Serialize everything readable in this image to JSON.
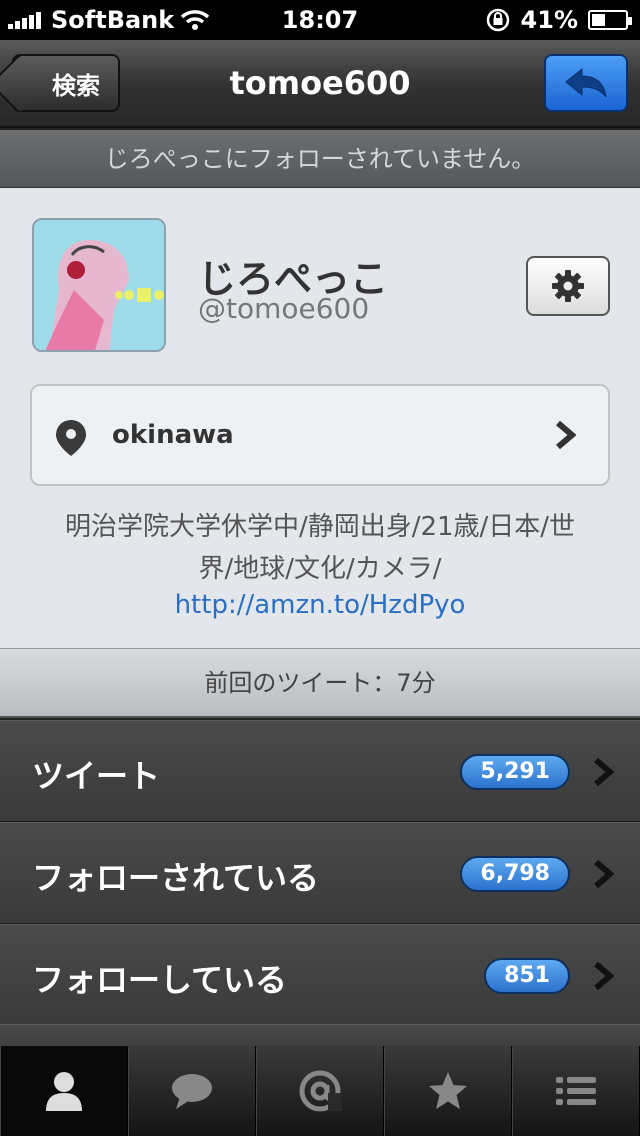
{
  "status_bar": {
    "carrier": "SoftBank",
    "time": "18:07",
    "battery": "41%",
    "battery_level": 0.41
  },
  "nav": {
    "back_label": "検索",
    "title": "tomoe600"
  },
  "follow_banner": "じろぺっこにフォローされていません。",
  "profile": {
    "display_name": "じろぺっこ",
    "username": "@tomoe600",
    "location": "okinawa",
    "bio_line1": "明治学院大学休学中/静岡出身/21歳/日本/世",
    "bio_line2": "界/地球/文化/カメラ/",
    "link": "http://amzn.to/HzdPyo"
  },
  "last_tweet": "前回のツイート：7分",
  "stats": [
    {
      "label": "ツイート",
      "count": "5,291"
    },
    {
      "label": "フォローされている",
      "count": "6,798"
    },
    {
      "label": "フォローしている",
      "count": "851"
    }
  ],
  "tabs": [
    {
      "icon": "person-icon",
      "active": true
    },
    {
      "icon": "speech-bubble-icon",
      "active": false
    },
    {
      "icon": "at-sign-icon",
      "active": false
    },
    {
      "icon": "star-icon",
      "active": false
    },
    {
      "icon": "list-icon",
      "active": false
    }
  ],
  "colors": {
    "accent_blue": "#2c72cf",
    "link_blue": "#2b6fc4",
    "nav_dark": "#333333"
  }
}
